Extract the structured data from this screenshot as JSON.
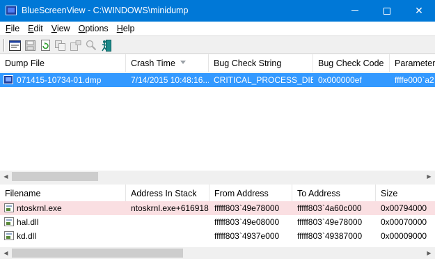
{
  "window": {
    "title": "BlueScreenView  -  C:\\WINDOWS\\minidump",
    "minimize_glyph": "",
    "maximize_glyph": "",
    "close_glyph": "✕"
  },
  "menu": [
    "File",
    "Edit",
    "View",
    "Options",
    "Help"
  ],
  "toolbar": {
    "buttons": [
      "properties-icon",
      "save-icon",
      "refresh-icon",
      "copy-icon",
      "options-icon",
      "find-icon",
      "exit-icon"
    ]
  },
  "upper_table": {
    "columns": [
      "Dump File",
      "Crash Time",
      "Bug Check String",
      "Bug Check Code",
      "Parameter"
    ],
    "sorted_column": "Crash Time",
    "rows": [
      {
        "dump_file": "071415-10734-01.dmp",
        "crash_time": "7/14/2015 10:48:16...",
        "bug_check_string": "CRITICAL_PROCESS_DIED",
        "bug_check_code": "0x000000ef",
        "parameter": "ffffe000`a2",
        "selected": true
      }
    ]
  },
  "lower_table": {
    "columns": [
      "Filename",
      "Address In Stack",
      "From Address",
      "To Address",
      "Size"
    ],
    "rows": [
      {
        "filename": "ntoskrnl.exe",
        "address_in_stack": "ntoskrnl.exe+616918",
        "from_address": "fffff803`49e78000",
        "to_address": "fffff803`4a60c000",
        "size": "0x00794000",
        "highlighted": true
      },
      {
        "filename": "hal.dll",
        "address_in_stack": "",
        "from_address": "fffff803`49e08000",
        "to_address": "fffff803`49e78000",
        "size": "0x00070000",
        "highlighted": false
      },
      {
        "filename": "kd.dll",
        "address_in_stack": "",
        "from_address": "fffff803`4937e000",
        "to_address": "fffff803`49387000",
        "size": "0x00009000",
        "highlighted": false
      }
    ]
  },
  "colors": {
    "titlebar": "#0078d7",
    "selected_row": "#3399ff",
    "highlight_row": "#fadfe2"
  }
}
